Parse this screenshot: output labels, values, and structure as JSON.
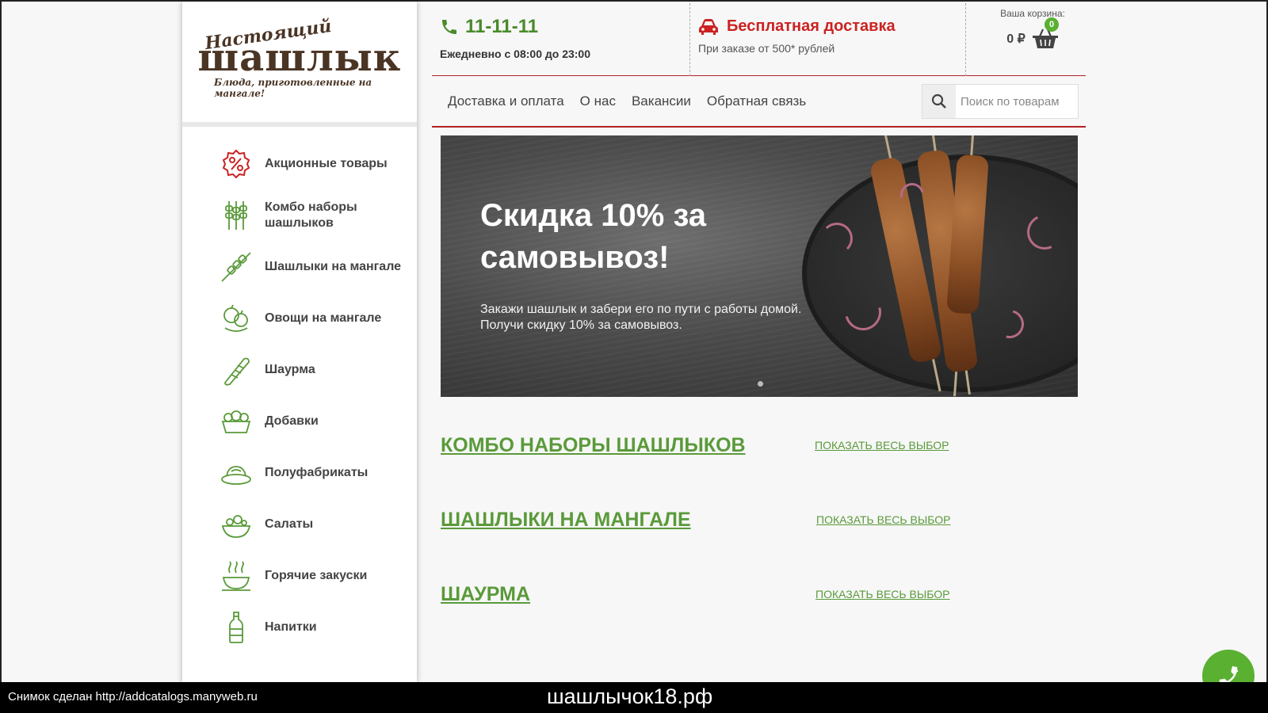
{
  "logo": {
    "line1": "Настоящий",
    "line2": "шашлык",
    "tagline": "Блюда, приготовленные на мангале!"
  },
  "header": {
    "phone": "11-11-11",
    "hours": "Ежедневно с 08:00 до 23:00",
    "delivery_title": "Бесплатная доставка",
    "delivery_sub": "При заказе от 500* рублей",
    "cart_label": "Ваша корзина:",
    "cart_sum": "0 ₽",
    "cart_count": "0"
  },
  "nav": {
    "links": [
      "Доставка и оплата",
      "О нас",
      "Вакансии",
      "Обратная связь"
    ],
    "search_placeholder": "Поиск по товарам"
  },
  "sidebar": {
    "items": [
      {
        "label": "Акционные товары",
        "icon": "percent-badge-icon"
      },
      {
        "label": "Комбо наборы шашлыков",
        "icon": "skewers-icon"
      },
      {
        "label": "Шашлыки на мангале",
        "icon": "skewer-icon"
      },
      {
        "label": "Овощи на мангале",
        "icon": "vegetables-icon"
      },
      {
        "label": "Шаурма",
        "icon": "shawarma-icon"
      },
      {
        "label": "Добавки",
        "icon": "sauce-bowl-icon"
      },
      {
        "label": "Полуфабрикаты",
        "icon": "semi-finished-icon"
      },
      {
        "label": "Салаты",
        "icon": "salad-icon"
      },
      {
        "label": "Горячие закуски",
        "icon": "hot-dish-icon"
      },
      {
        "label": "Напитки",
        "icon": "bottle-icon"
      }
    ]
  },
  "banner": {
    "title": "Скидка 10% за самовывоз!",
    "text": "Закажи шашлык и забери его по пути с работы домой. Получи скидку 10% за самовывоз."
  },
  "sections": [
    {
      "title": "КОМБО НАБОРЫ ШАШЛЫКОВ",
      "link": "ПОКАЗАТЬ ВЕСЬ ВЫБОР"
    },
    {
      "title": "ШАШЛЫКИ НА МАНГАЛЕ",
      "link": "ПОКАЗАТЬ ВЕСЬ ВЫБОР"
    },
    {
      "title": "ШАУРМА",
      "link": "ПОКАЗАТЬ ВЕСЬ ВЫБОР"
    }
  ],
  "caption": {
    "left": "Снимок сделан http://addcatalogs.manyweb.ru",
    "center": "шашлычок18.рф"
  },
  "colors": {
    "accent_green": "#5a9a3a",
    "accent_red": "#cc2222",
    "badge_green": "#5ab031"
  }
}
